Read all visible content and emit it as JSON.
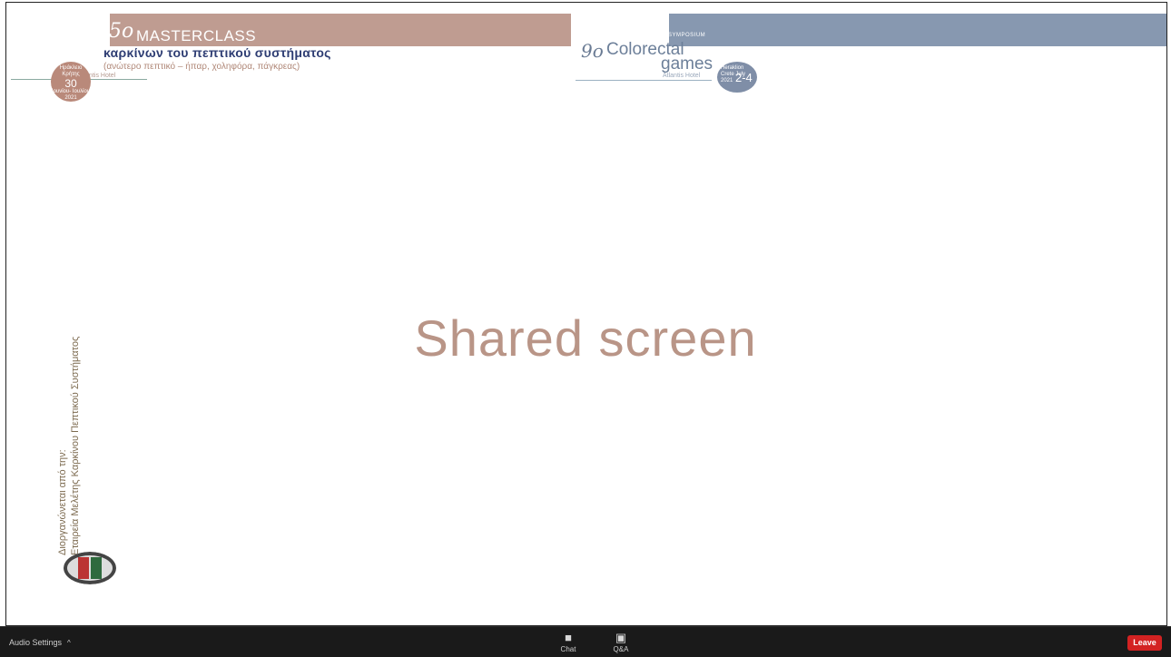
{
  "slide": {
    "masterclass": {
      "number": "5ο",
      "title": "MASTERCLASS",
      "subtitle": "καρκίνων του πεπτικού συστήματος",
      "topics": "(ανώτερο πεπτικό – ήπαρ, χοληφόρα, πάγκρεας)",
      "venue": "Atlantis Hotel",
      "badge_top": "Ηράκλειο Κρήτης",
      "badge_day": "30",
      "badge_bottom": "Ιουνίου- Ιουλίου 2021"
    },
    "colorectal": {
      "symposium": "SYMPOSIUM",
      "number": "9ο",
      "title_line1": "Colorectal",
      "title_line2": "games",
      "venue": "Atlantis Hotel",
      "badge_small": "Heraklion Crete July 2021",
      "badge_days": "2-4"
    },
    "organizer_line1": "Διοργανώνεται από την:",
    "organizer_line2": "Εταιρεία Μελέτης Καρκίνου Πεπτικού Συστήματος"
  },
  "center_text": "Shared screen",
  "toolbar": {
    "audio_settings": "Audio Settings",
    "chat_label": "Chat",
    "qa_label": "Q&A",
    "leave_label": "Leave"
  },
  "colors": {
    "toolbar_bg": "#1a1a1a",
    "leave_red": "#d32222",
    "banner_left": "#bf9c91",
    "banner_right": "#8798b0",
    "shared_text": "#b99587"
  }
}
